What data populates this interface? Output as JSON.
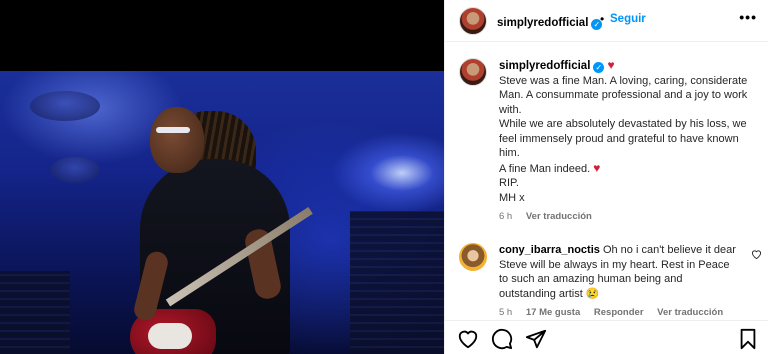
{
  "post": {
    "username": "simplyredofficial",
    "follow_label": "Seguir",
    "separator": "•",
    "more_label": "•••",
    "verified_mark": "✓"
  },
  "caption": {
    "username": "simplyredofficial",
    "heart": "♥",
    "text": "Steve was a fine Man. A loving, caring, considerate Man. A consummate professional and a joy to work with.\nWhile we are absolutely devastated by his loss, we feel immensely proud and grateful to have known him.",
    "line_fine": "A fine Man indeed.",
    "line_rip": "RIP.",
    "line_sign": "MH x",
    "time": "6 h",
    "translate": "Ver traducción"
  },
  "comment": {
    "username": "cony_ibarra_noctis",
    "text": "Oh no i can't believe it dear Steve will be always in my heart. Rest in Peace to such an amazing human being and outstanding artist",
    "emoji": "😢",
    "time": "5 h",
    "likes": "17 Me gusta",
    "reply": "Responder",
    "translate": "Ver traducción",
    "like_icon": "heart-outline-icon"
  },
  "icons": {
    "like": "heart-outline-icon",
    "comment": "comment-bubble-icon",
    "share": "paper-plane-icon",
    "save": "bookmark-icon"
  },
  "colors": {
    "link_blue": "#0095f6",
    "heart_red": "#d1203a",
    "meta_gray": "#737373"
  }
}
